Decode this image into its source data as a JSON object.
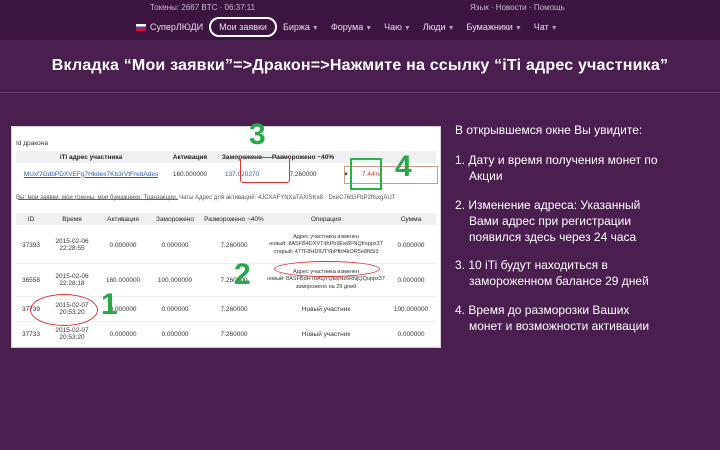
{
  "top": {
    "info_left": "Токены: 2667 BTC · 06:37:11",
    "info_right": "Язык · Новости · Помощь"
  },
  "nav": {
    "brand": "СуперЛЮДИ",
    "items": [
      "Мои заявки",
      "Биржа",
      "Форума",
      "Чаю",
      "Люди",
      "Бумажники",
      "Чат"
    ]
  },
  "slide_title": "Вкладка “Мои заявки”=>Дракон=>Нажмите на ссылку “iTi адрес участника”",
  "panel": {
    "title": "Id дракона",
    "top_table": {
      "headers": [
        "iTi адрес участника",
        "Активация",
        "Заморожено",
        "Разморожено ~40%",
        "",
        "",
        ""
      ],
      "row": [
        "MUxf7GdbPDXVEFg7Hkdes7Kb3rVtFrebAdes",
        "160.000000",
        "137.020270",
        "7.260000",
        "▾",
        "7.44%",
        ""
      ]
    },
    "sub_links": "Вы: мои заявки, мои токены, мои бумажники, Транзакции, Чаты                  Адрес для активаций: 4JCXAFYNXaTAXiSKe8 · DxeC76tGFbP2ffsxgAUT",
    "headers": [
      "ID",
      "Время",
      "Активация",
      "Заморожено",
      "Разморожено ~40%",
      "Операция",
      "Сумма"
    ],
    "rows": [
      {
        "id": "37393",
        "time": "2015-02-06\n22:28:55",
        "act": "0.000000",
        "frz": "0.000000",
        "unf": "7.260000",
        "op": "Адрес участника изменен\nновый: 8ASFB4DXVTdhPb9Ew8FNQfrsppx37\nстарый: 477F8HDIUTYbPfbf4kOR5e8fk5i3",
        "sum": "0.000000"
      },
      {
        "id": "36558",
        "time": "2015-02-06\n22:28:18",
        "act": "160.000000",
        "frz": "100.000000",
        "unf": "7.260000",
        "op": "Адрес участника изменен\nновый: 8ASFBdHTbAQTQEoNz6RNjQQuppx37\nзаморожено на 29 дней",
        "sum": "0.000000"
      },
      {
        "id": "37739",
        "time": "2015-02-07\n20:53:20",
        "act": "0.000000",
        "frz": "0.000000",
        "unf": "7.260000",
        "op": "Новый участник",
        "sum": "100.000000"
      },
      {
        "id": "37733",
        "time": "2015-02-07\n20:53:20",
        "act": "0.000000",
        "frz": "0.000000",
        "unf": "7.260000",
        "op": "Новый участник",
        "sum": "0.000000"
      }
    ]
  },
  "markers": {
    "m1": "1",
    "m2": "2",
    "m3": "3",
    "m4": "4"
  },
  "right": {
    "heading": "В открывшемся окне Вы увидите:",
    "items": [
      {
        "l1": "1. Дату и время получения монет по",
        "l2": "Акции"
      },
      {
        "l1": "2. Изменение адреса: Указанный",
        "l2": "Вами адрес при регистрации",
        "l3": "появился здесь через 24 часа"
      },
      {
        "l1": "3. 10 iTi будут находиться в",
        "l2": "замороженном балансе 29 дней"
      },
      {
        "l1": "4. Время до разморозки Ваших",
        "l2": "монет и возможности активации"
      }
    ]
  },
  "colors": {
    "background": "#4a1f4f",
    "marker": "#28a84a",
    "highlight": "#d33333"
  }
}
